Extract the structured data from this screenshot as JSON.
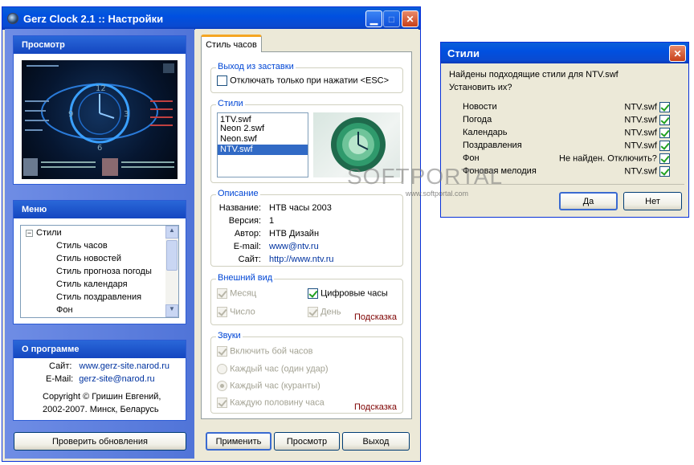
{
  "main_window": {
    "title": "Gerz Clock 2.1 :: Настройки",
    "preview": {
      "header": "Просмотр"
    },
    "menu": {
      "header": "Меню",
      "root": "Стили",
      "items": [
        "Стиль часов",
        "Стиль новостей",
        "Стиль прогноза погоды",
        "Стиль календаря",
        "Стиль поздравления",
        "Фон"
      ]
    },
    "about": {
      "header": "О программе",
      "site_label": "Сайт:",
      "site": "www.gerz-site.narod.ru",
      "email_label": "E-Mail:",
      "email": "gerz-site@narod.ru",
      "copyright1": "Copyright © Гришин Евгений,",
      "copyright2": "2002-2007. Минск, Беларусь"
    },
    "check_updates": "Проверить обновления",
    "tab": "Стиль часов",
    "exit": {
      "title": "Выход из заставки",
      "option": "Отключать только при нажатии <ESC>"
    },
    "styles": {
      "title": "Стили",
      "items": [
        "1TV.swf",
        "Neon 2.swf",
        "Neon.swf",
        "NTV.swf"
      ],
      "selected": 3
    },
    "description": {
      "title": "Описание",
      "labels": [
        "Название:",
        "Версия:",
        "Автор:",
        "E-mail:",
        "Сайт:"
      ],
      "values": [
        "НТВ часы 2003",
        "1",
        "НТВ Дизайн",
        "www@ntv.ru",
        "http://www.ntv.ru"
      ]
    },
    "appearance": {
      "title": "Внешний вид",
      "month": "Месяц",
      "digital": "Цифровые часы",
      "number": "Число",
      "day": "День",
      "hint": "Подсказка"
    },
    "sounds": {
      "title": "Звуки",
      "chime": "Включить бой часов",
      "hourly_one": "Каждый час (один удар)",
      "hourly_chimes": "Каждый час (куранты)",
      "half_hour": "Каждую половину часа",
      "hint": "Подсказка"
    },
    "buttons": {
      "apply": "Применить",
      "preview": "Просмотр",
      "exit": "Выход"
    }
  },
  "dialog": {
    "title": "Стили",
    "message1": "Найдены подходящие стили для NTV.swf",
    "message2": "Установить их?",
    "rows": [
      {
        "name": "Новости",
        "value": "NTV.swf"
      },
      {
        "name": "Погода",
        "value": "NTV.swf"
      },
      {
        "name": "Календарь",
        "value": "NTV.swf"
      },
      {
        "name": "Поздравления",
        "value": "NTV.swf"
      },
      {
        "name": "Фон",
        "value": "Не найден. Отключить?"
      },
      {
        "name": "Фоновая мелодия",
        "value": "NTV.swf"
      }
    ],
    "yes": "Да",
    "no": "Нет"
  },
  "watermark": {
    "brand": "SOFTPORTAL",
    "url": "www.softportal.com"
  }
}
